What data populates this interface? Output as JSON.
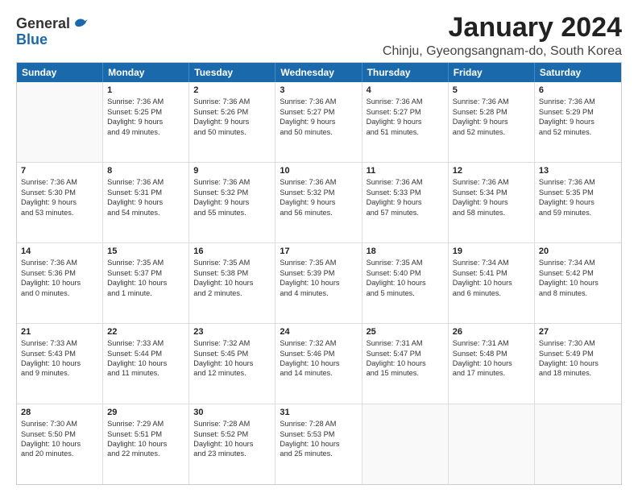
{
  "logo": {
    "general": "General",
    "blue": "Blue"
  },
  "title": "January 2024",
  "subtitle": "Chinju, Gyeongsangnam-do, South Korea",
  "days": [
    "Sunday",
    "Monday",
    "Tuesday",
    "Wednesday",
    "Thursday",
    "Friday",
    "Saturday"
  ],
  "weeks": [
    [
      {
        "day": "",
        "data": []
      },
      {
        "day": "1",
        "data": [
          "Sunrise: 7:36 AM",
          "Sunset: 5:25 PM",
          "Daylight: 9 hours",
          "and 49 minutes."
        ]
      },
      {
        "day": "2",
        "data": [
          "Sunrise: 7:36 AM",
          "Sunset: 5:26 PM",
          "Daylight: 9 hours",
          "and 50 minutes."
        ]
      },
      {
        "day": "3",
        "data": [
          "Sunrise: 7:36 AM",
          "Sunset: 5:27 PM",
          "Daylight: 9 hours",
          "and 50 minutes."
        ]
      },
      {
        "day": "4",
        "data": [
          "Sunrise: 7:36 AM",
          "Sunset: 5:27 PM",
          "Daylight: 9 hours",
          "and 51 minutes."
        ]
      },
      {
        "day": "5",
        "data": [
          "Sunrise: 7:36 AM",
          "Sunset: 5:28 PM",
          "Daylight: 9 hours",
          "and 52 minutes."
        ]
      },
      {
        "day": "6",
        "data": [
          "Sunrise: 7:36 AM",
          "Sunset: 5:29 PM",
          "Daylight: 9 hours",
          "and 52 minutes."
        ]
      }
    ],
    [
      {
        "day": "7",
        "data": [
          "Sunrise: 7:36 AM",
          "Sunset: 5:30 PM",
          "Daylight: 9 hours",
          "and 53 minutes."
        ]
      },
      {
        "day": "8",
        "data": [
          "Sunrise: 7:36 AM",
          "Sunset: 5:31 PM",
          "Daylight: 9 hours",
          "and 54 minutes."
        ]
      },
      {
        "day": "9",
        "data": [
          "Sunrise: 7:36 AM",
          "Sunset: 5:32 PM",
          "Daylight: 9 hours",
          "and 55 minutes."
        ]
      },
      {
        "day": "10",
        "data": [
          "Sunrise: 7:36 AM",
          "Sunset: 5:32 PM",
          "Daylight: 9 hours",
          "and 56 minutes."
        ]
      },
      {
        "day": "11",
        "data": [
          "Sunrise: 7:36 AM",
          "Sunset: 5:33 PM",
          "Daylight: 9 hours",
          "and 57 minutes."
        ]
      },
      {
        "day": "12",
        "data": [
          "Sunrise: 7:36 AM",
          "Sunset: 5:34 PM",
          "Daylight: 9 hours",
          "and 58 minutes."
        ]
      },
      {
        "day": "13",
        "data": [
          "Sunrise: 7:36 AM",
          "Sunset: 5:35 PM",
          "Daylight: 9 hours",
          "and 59 minutes."
        ]
      }
    ],
    [
      {
        "day": "14",
        "data": [
          "Sunrise: 7:36 AM",
          "Sunset: 5:36 PM",
          "Daylight: 10 hours",
          "and 0 minutes."
        ]
      },
      {
        "day": "15",
        "data": [
          "Sunrise: 7:35 AM",
          "Sunset: 5:37 PM",
          "Daylight: 10 hours",
          "and 1 minute."
        ]
      },
      {
        "day": "16",
        "data": [
          "Sunrise: 7:35 AM",
          "Sunset: 5:38 PM",
          "Daylight: 10 hours",
          "and 2 minutes."
        ]
      },
      {
        "day": "17",
        "data": [
          "Sunrise: 7:35 AM",
          "Sunset: 5:39 PM",
          "Daylight: 10 hours",
          "and 4 minutes."
        ]
      },
      {
        "day": "18",
        "data": [
          "Sunrise: 7:35 AM",
          "Sunset: 5:40 PM",
          "Daylight: 10 hours",
          "and 5 minutes."
        ]
      },
      {
        "day": "19",
        "data": [
          "Sunrise: 7:34 AM",
          "Sunset: 5:41 PM",
          "Daylight: 10 hours",
          "and 6 minutes."
        ]
      },
      {
        "day": "20",
        "data": [
          "Sunrise: 7:34 AM",
          "Sunset: 5:42 PM",
          "Daylight: 10 hours",
          "and 8 minutes."
        ]
      }
    ],
    [
      {
        "day": "21",
        "data": [
          "Sunrise: 7:33 AM",
          "Sunset: 5:43 PM",
          "Daylight: 10 hours",
          "and 9 minutes."
        ]
      },
      {
        "day": "22",
        "data": [
          "Sunrise: 7:33 AM",
          "Sunset: 5:44 PM",
          "Daylight: 10 hours",
          "and 11 minutes."
        ]
      },
      {
        "day": "23",
        "data": [
          "Sunrise: 7:32 AM",
          "Sunset: 5:45 PM",
          "Daylight: 10 hours",
          "and 12 minutes."
        ]
      },
      {
        "day": "24",
        "data": [
          "Sunrise: 7:32 AM",
          "Sunset: 5:46 PM",
          "Daylight: 10 hours",
          "and 14 minutes."
        ]
      },
      {
        "day": "25",
        "data": [
          "Sunrise: 7:31 AM",
          "Sunset: 5:47 PM",
          "Daylight: 10 hours",
          "and 15 minutes."
        ]
      },
      {
        "day": "26",
        "data": [
          "Sunrise: 7:31 AM",
          "Sunset: 5:48 PM",
          "Daylight: 10 hours",
          "and 17 minutes."
        ]
      },
      {
        "day": "27",
        "data": [
          "Sunrise: 7:30 AM",
          "Sunset: 5:49 PM",
          "Daylight: 10 hours",
          "and 18 minutes."
        ]
      }
    ],
    [
      {
        "day": "28",
        "data": [
          "Sunrise: 7:30 AM",
          "Sunset: 5:50 PM",
          "Daylight: 10 hours",
          "and 20 minutes."
        ]
      },
      {
        "day": "29",
        "data": [
          "Sunrise: 7:29 AM",
          "Sunset: 5:51 PM",
          "Daylight: 10 hours",
          "and 22 minutes."
        ]
      },
      {
        "day": "30",
        "data": [
          "Sunrise: 7:28 AM",
          "Sunset: 5:52 PM",
          "Daylight: 10 hours",
          "and 23 minutes."
        ]
      },
      {
        "day": "31",
        "data": [
          "Sunrise: 7:28 AM",
          "Sunset: 5:53 PM",
          "Daylight: 10 hours",
          "and 25 minutes."
        ]
      },
      {
        "day": "",
        "data": []
      },
      {
        "day": "",
        "data": []
      },
      {
        "day": "",
        "data": []
      }
    ]
  ]
}
